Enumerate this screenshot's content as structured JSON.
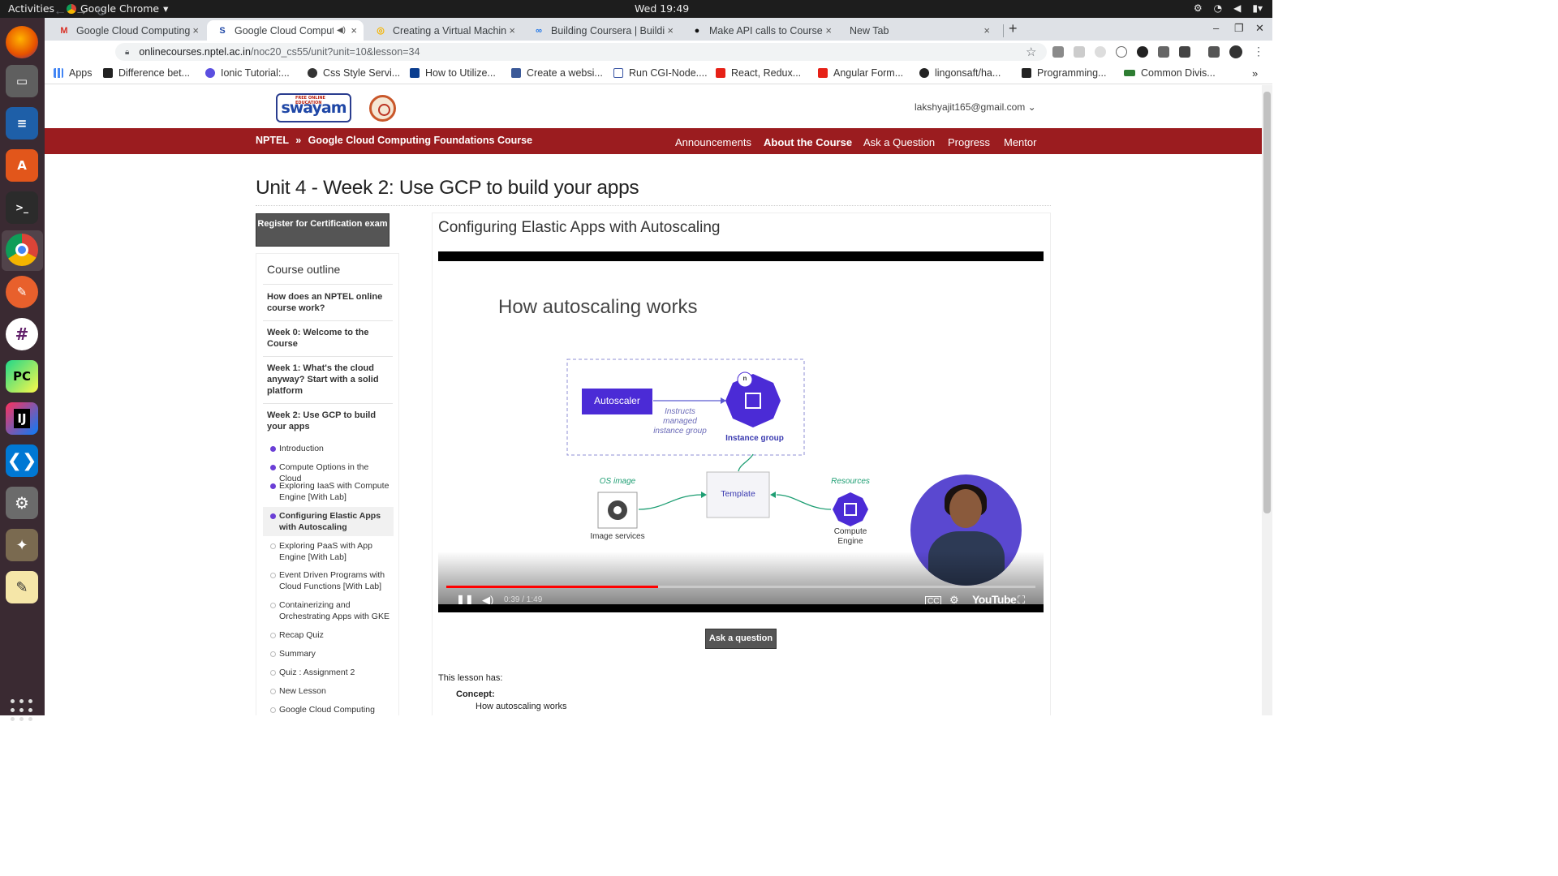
{
  "system": {
    "activities": "Activities",
    "app_name": "Google Chrome",
    "clock": "Wed 19:49"
  },
  "tabs": [
    {
      "title": "Google Cloud Computing",
      "favicon": "gmail-icon",
      "close": "×"
    },
    {
      "title": "Google Cloud Comput",
      "favicon": "swayam-icon",
      "close": "×"
    },
    {
      "title": "Creating a Virtual Machin",
      "favicon": "qwiklabs-icon",
      "close": "×"
    },
    {
      "title": "Building Coursera | Buildi",
      "favicon": "coursera-icon",
      "close": "×"
    },
    {
      "title": "Make API calls to Courser",
      "favicon": "github-icon",
      "close": "×"
    },
    {
      "title": "New Tab",
      "favicon": "",
      "close": "×"
    }
  ],
  "new_tab": "+",
  "address": {
    "host": "onlinecourses.nptel.ac.in",
    "path": "/noc20_cs55/unit?unit=10&lesson=34"
  },
  "bookmarks": [
    {
      "label": "Apps",
      "color": "#4285f4"
    },
    {
      "label": "Difference bet...",
      "color": "#222"
    },
    {
      "label": "Ionic Tutorial:...",
      "color": "#5b4fe0"
    },
    {
      "label": "Css Style Servi...",
      "color": "#333"
    },
    {
      "label": "How to Utilize...",
      "color": "#0a3d8f"
    },
    {
      "label": "Create a websi...",
      "color": "#3b5998"
    },
    {
      "label": "Run CGI-Node....",
      "color": "#3a55a4"
    },
    {
      "label": "React, Redux...",
      "color": "#e62117"
    },
    {
      "label": "Angular Form...",
      "color": "#e62117"
    },
    {
      "label": "lingonsaft/ha...",
      "color": "#222"
    },
    {
      "label": "Programming...",
      "color": "#222"
    },
    {
      "label": "Common Divis...",
      "color": "#2e7d32"
    }
  ],
  "site": {
    "logo_text": "swayam",
    "logo_small": "FREE ONLINE EDUCATION",
    "user_email": "lakshyajit165@gmail.com",
    "breadcrumb_home": "NPTEL",
    "breadcrumb_sep": "»",
    "breadcrumb_course": "Google Cloud Computing Foundations Course",
    "nav": [
      "Announcements",
      "About the Course",
      "Ask a Question",
      "Progress",
      "Mentor"
    ]
  },
  "unit_title": "Unit 4 - Week 2: Use GCP to build your apps",
  "register_button": "Register for Certification exam",
  "outline": {
    "heading": "Course outline",
    "weeks": [
      "How does an NPTEL online course work?",
      "Week 0: Welcome to the Course",
      "Week 1: What's the cloud anyway? Start with a solid platform",
      "Week 2: Use GCP to build your apps"
    ],
    "lessons": [
      {
        "label": "Introduction",
        "state": "done"
      },
      {
        "label": "Compute Options in the Cloud",
        "state": "done"
      },
      {
        "label": "Exploring IaaS with Compute Engine [With Lab]",
        "state": "done"
      },
      {
        "label": "Configuring Elastic Apps with Autoscaling",
        "state": "current"
      },
      {
        "label": "Exploring PaaS with App Engine [With Lab]",
        "state": "todo"
      },
      {
        "label": "Event Driven Programs with Cloud Functions [With Lab]",
        "state": "todo"
      },
      {
        "label": "Containerizing and Orchestrating Apps with GKE",
        "state": "todo"
      },
      {
        "label": "Recap Quiz",
        "state": "todo"
      },
      {
        "label": "Summary",
        "state": "todo"
      },
      {
        "label": "Quiz : Assignment 2",
        "state": "todo"
      },
      {
        "label": "New Lesson",
        "state": "todo"
      },
      {
        "label": "Google Cloud Computing",
        "state": "todo"
      }
    ]
  },
  "lesson_title": "Configuring Elastic Apps with Autoscaling",
  "video": {
    "slide_title": "How autoscaling works",
    "autoscaler": "Autoscaler",
    "instructs_label": "Instructs managed instance group",
    "n_badge": "n",
    "instance_group": "Instance group",
    "os_image": "OS image",
    "template": "Template",
    "resources": "Resources",
    "image_services": "Image services",
    "compute_engine_1": "Compute",
    "compute_engine_2": "Engine",
    "time": "0:39 / 1:49",
    "progress": 0.36,
    "youtube": "YouTube"
  },
  "ask_button": "Ask a question",
  "lesson_has": "This lesson has:",
  "concept_label": "Concept:",
  "concept_value": "How autoscaling works"
}
